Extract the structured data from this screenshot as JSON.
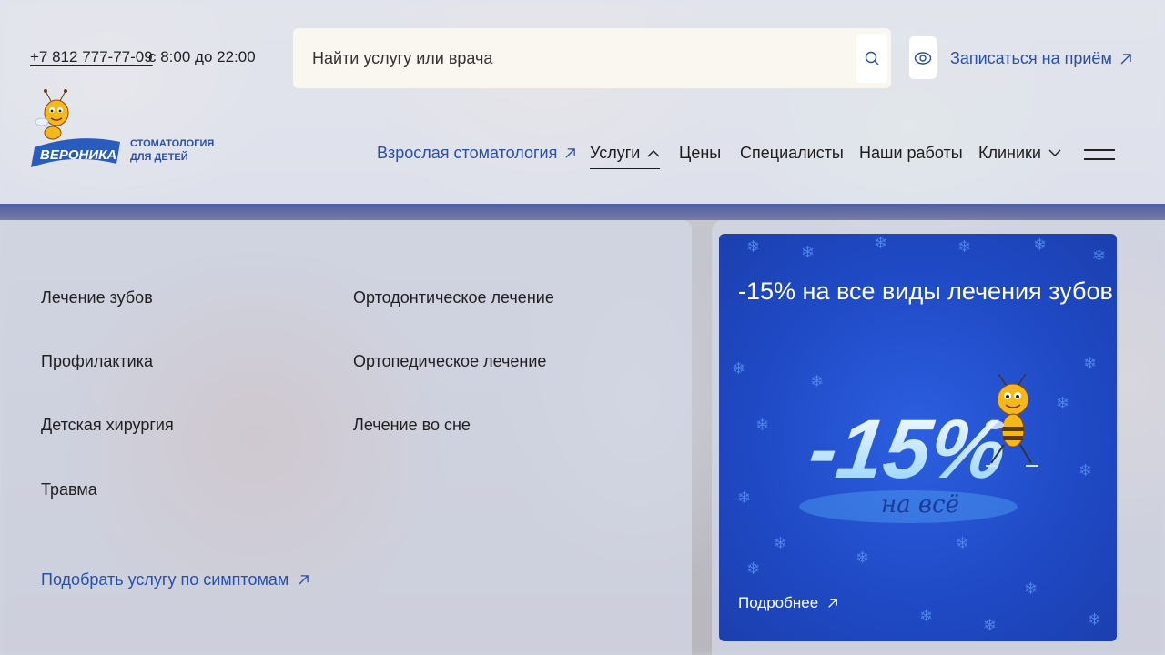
{
  "header": {
    "phone": "+7 812 777-77-09",
    "hours": "с 8:00 до 22:00",
    "search_placeholder": "Найти услугу или врача",
    "appointment_label": "Записаться на приём"
  },
  "logo": {
    "brand": "ВЕРОНИКА",
    "subtitle_line1": "СТОМАТОЛОГИЯ",
    "subtitle_line2": "ДЛЯ ДЕТЕЙ"
  },
  "nav": {
    "adult": "Взрослая стоматология",
    "services": "Услуги",
    "prices": "Цены",
    "specialists": "Специалисты",
    "works": "Наши работы",
    "clinics": "Клиники"
  },
  "services": {
    "col1": [
      "Лечение зубов",
      "Профилактика",
      "Детская хирургия",
      "Травма"
    ],
    "col2": [
      "Ортодонтическое лечение",
      "Ортопедическое лечение",
      "Лечение во сне"
    ],
    "symptoms_link": "Подобрать услугу по симптомам"
  },
  "promo": {
    "title": "-15% на все виды лечения зубов",
    "big_text": "-15%",
    "script_text": "на всё",
    "more_label": "Подробнее"
  },
  "colors": {
    "accent": "#2a4fa8",
    "promo_bg": "#1f49c4"
  }
}
